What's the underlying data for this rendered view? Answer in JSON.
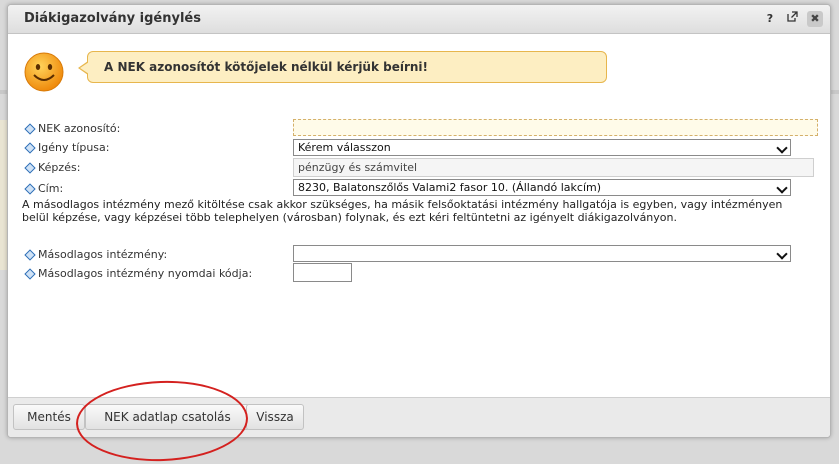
{
  "dialog": {
    "title": "Diákigazolvány igénylés",
    "help_icon": "?",
    "close_icon": "✖"
  },
  "notice": {
    "text": "A NEK azonosítót kötőjelek nélkül kérjük beírni!"
  },
  "form": {
    "nek_label": "NEK azonosító:",
    "nek_value": "",
    "igeny_label": "Igény típusa:",
    "igeny_value": "Kérem válasszon",
    "kepzes_label": "Képzés:",
    "kepzes_value": "pénzügy és számvitel",
    "cim_label": "Cím:",
    "cim_value": "8230, Balatonszőlős Valami2 fasor 10. (Állandó lakcím)",
    "note": "A másodlagos intézmény mező kitöltése csak akkor szükséges, ha másik felsőoktatási intézmény hallgatója is egyben, vagy intézményen belül képzése, vagy képzései több telephelyen (városban) folynak, és ezt kéri feltüntetni az igényelt diákigazolványon.",
    "masodlagos_label": "Másodlagos intézmény:",
    "masodlagos_value": "",
    "nyomdai_label": "Másodlagos intézmény nyomdai kódja:",
    "nyomdai_value": ""
  },
  "footer": {
    "save_label": "Mentés",
    "nek_attach_label": "NEK adatlap csatolás",
    "back_label": "Vissza"
  },
  "colors": {
    "callout_bg": "#fdeec2",
    "callout_border": "#e7b64d",
    "annotation_circle": "#d4211f"
  }
}
